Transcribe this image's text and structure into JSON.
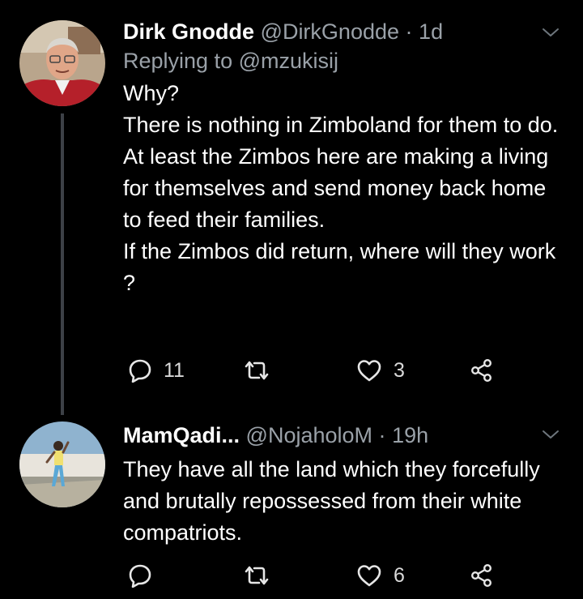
{
  "tweets": [
    {
      "name": "Dirk Gnodde",
      "handle": "@DirkGnodde",
      "separator": "·",
      "time": "1d",
      "replying_prefix": "Replying to",
      "replying_to": "@mzukisij",
      "body_lines": [
        "Why?",
        "There is nothing in Zimboland for them to do.",
        "At least the Zimbos here are making a living for themselves and send money back home to feed their families.",
        "If the Zimbos did return,  where will they work ?"
      ],
      "replies": "11",
      "retweets": "",
      "likes": "3"
    },
    {
      "name": "MamQadi...",
      "handle": "@NojaholoM",
      "separator": "·",
      "time": "19h",
      "body_lines": [
        "They have all the land which they forcefully and brutally repossessed from their white compatriots."
      ],
      "replies": "",
      "retweets": "",
      "likes": "6"
    }
  ],
  "icons": {
    "reply": "reply-icon",
    "retweet": "retweet-icon",
    "like": "heart-icon",
    "share": "share-icon",
    "menu": "chevron-down-icon"
  },
  "colors": {
    "background": "#000000",
    "text": "#ffffff",
    "secondary": "#9aa1a8",
    "thread_line": "#3d4147"
  }
}
